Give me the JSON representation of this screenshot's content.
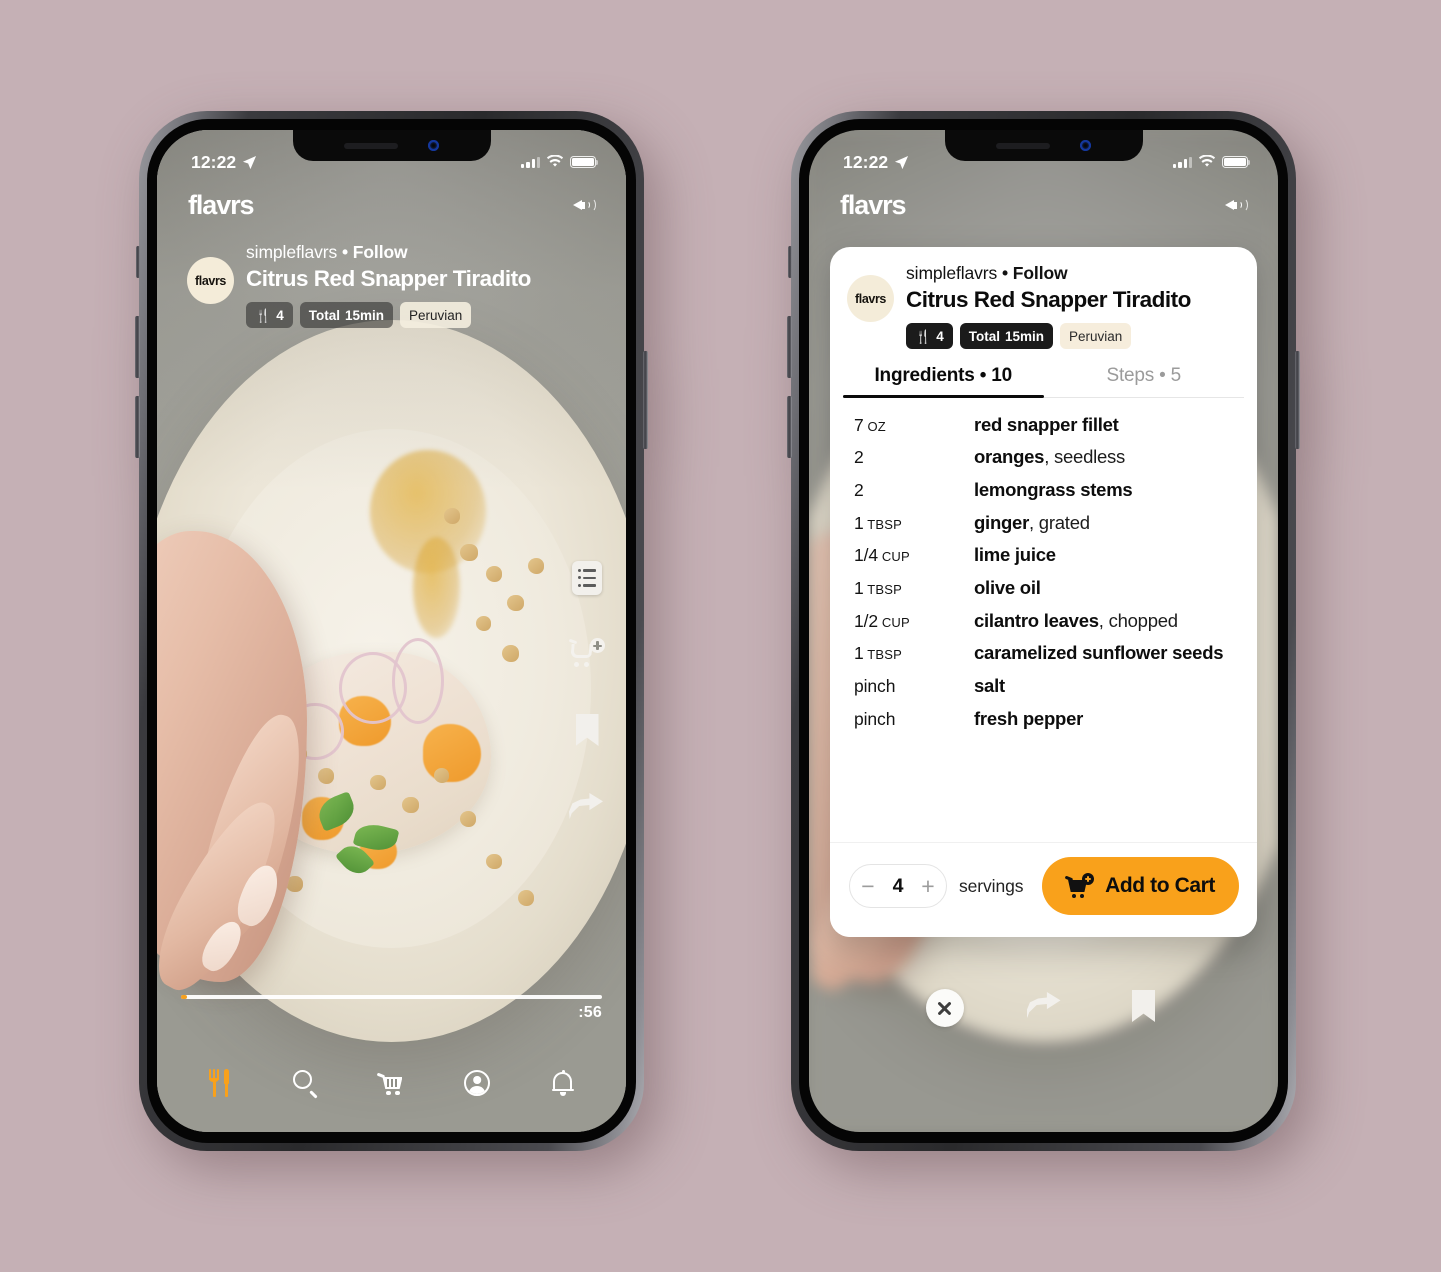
{
  "theme": {
    "page_background": "#c5b0b5",
    "accent_orange": "#f9a11b",
    "cream": "#f4ecd9",
    "card_background": "#ffffff"
  },
  "status_bar": {
    "time": "12:22",
    "location_icon": "location-arrow-icon",
    "signal_icon": "cellular-signal-icon",
    "wifi_icon": "wifi-icon",
    "battery_icon": "battery-icon"
  },
  "app_header": {
    "brand": "flavrs",
    "mute_icon": "speaker-mute-icon"
  },
  "recipe": {
    "author": "simpleflavrs",
    "separator": "•",
    "follow_label": "Follow",
    "title": "Citrus Red Snapper Tiradito",
    "avatar_label": "flavrs",
    "chips": {
      "servings_icon": "cutlery-icon",
      "servings_value": "4",
      "total_prefix": "Total ",
      "total_value": "15min",
      "cuisine": "Peruvian"
    }
  },
  "video": {
    "progress_percent": 1.5,
    "time_remaining": ":56",
    "side_actions": [
      {
        "name": "recipe-list-icon",
        "label": "Recipe list"
      },
      {
        "name": "add-to-cart-icon",
        "label": "Add to cart"
      },
      {
        "name": "bookmark-icon",
        "label": "Save"
      },
      {
        "name": "share-icon",
        "label": "Share"
      }
    ]
  },
  "tab_bar": [
    {
      "icon": "cutlery-icon",
      "label": "Feed",
      "active": true
    },
    {
      "icon": "search-icon",
      "label": "Search",
      "active": false
    },
    {
      "icon": "cart-icon",
      "label": "Cart",
      "active": false
    },
    {
      "icon": "profile-icon",
      "label": "Profile",
      "active": false
    },
    {
      "icon": "bell-icon",
      "label": "Notifications",
      "active": false
    }
  ],
  "sheet": {
    "tabs": [
      {
        "label": "Ingredients • 10",
        "active": true
      },
      {
        "label": "Steps • 5",
        "active": false
      }
    ],
    "ingredients": [
      {
        "amount": "7",
        "unit": "OZ",
        "name": "red snapper fillet",
        "note": ""
      },
      {
        "amount": "2",
        "unit": "",
        "name": "oranges",
        "note": ", seedless"
      },
      {
        "amount": "2",
        "unit": "",
        "name": "lemongrass stems",
        "note": ""
      },
      {
        "amount": "1",
        "unit": "TBSP",
        "name": "ginger",
        "note": ", grated"
      },
      {
        "amount": "1/4",
        "unit": "CUP",
        "name": "lime juice",
        "note": ""
      },
      {
        "amount": "1",
        "unit": "TBSP",
        "name": "olive oil",
        "note": ""
      },
      {
        "amount": "1/2",
        "unit": "CUP",
        "name": "cilantro leaves",
        "note": ", chopped"
      },
      {
        "amount": "1",
        "unit": "TBSP",
        "name": "caramelized sunflower seeds",
        "note": ""
      },
      {
        "amount": "pinch",
        "unit": "",
        "name": "salt",
        "note": ""
      },
      {
        "amount": "pinch",
        "unit": "",
        "name": "fresh pepper",
        "note": ""
      }
    ],
    "footer": {
      "minus_label": "−",
      "servings_value": "4",
      "plus_label": "+",
      "servings_label": "servings",
      "add_to_cart_label": "Add to Cart",
      "add_to_cart_icon": "cart-plus-icon"
    },
    "actions": [
      {
        "name": "close-icon",
        "label": "Close"
      },
      {
        "name": "share-icon",
        "label": "Share"
      },
      {
        "name": "bookmark-icon",
        "label": "Save"
      }
    ]
  }
}
